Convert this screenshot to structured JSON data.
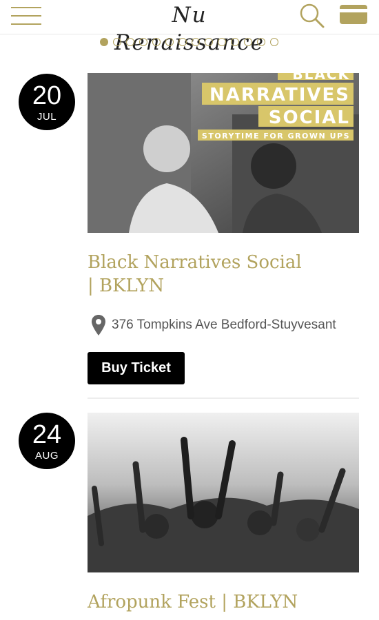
{
  "header": {
    "brand": "Nu Renaissance",
    "icons": {
      "menu": "hamburger-menu-icon",
      "search": "search-icon",
      "card": "credit-card-icon"
    }
  },
  "carousel": {
    "total_dots": 14,
    "active_index": 0
  },
  "events": [
    {
      "day": "20",
      "month": "JUL",
      "title": "Black Narratives Social | BKLYN",
      "title_line1": "Black Narratives Social",
      "title_line2": "| BKLYN",
      "poster": {
        "line_top": "BLACK",
        "line_mid": "NARRATIVES",
        "line_bottom": "SOCIAL",
        "tagline": "STORYTIME FOR GROWN UPS"
      },
      "location": "376 Tompkins Ave Bedford-Stuyvesant",
      "buy_label": "Buy Ticket"
    },
    {
      "day": "24",
      "month": "AUG",
      "title": "Afropunk Fest | BKLYN"
    }
  ],
  "colors": {
    "accent": "#b2a35e",
    "badge": "#000000",
    "poster_bar": "#d8c66a"
  }
}
